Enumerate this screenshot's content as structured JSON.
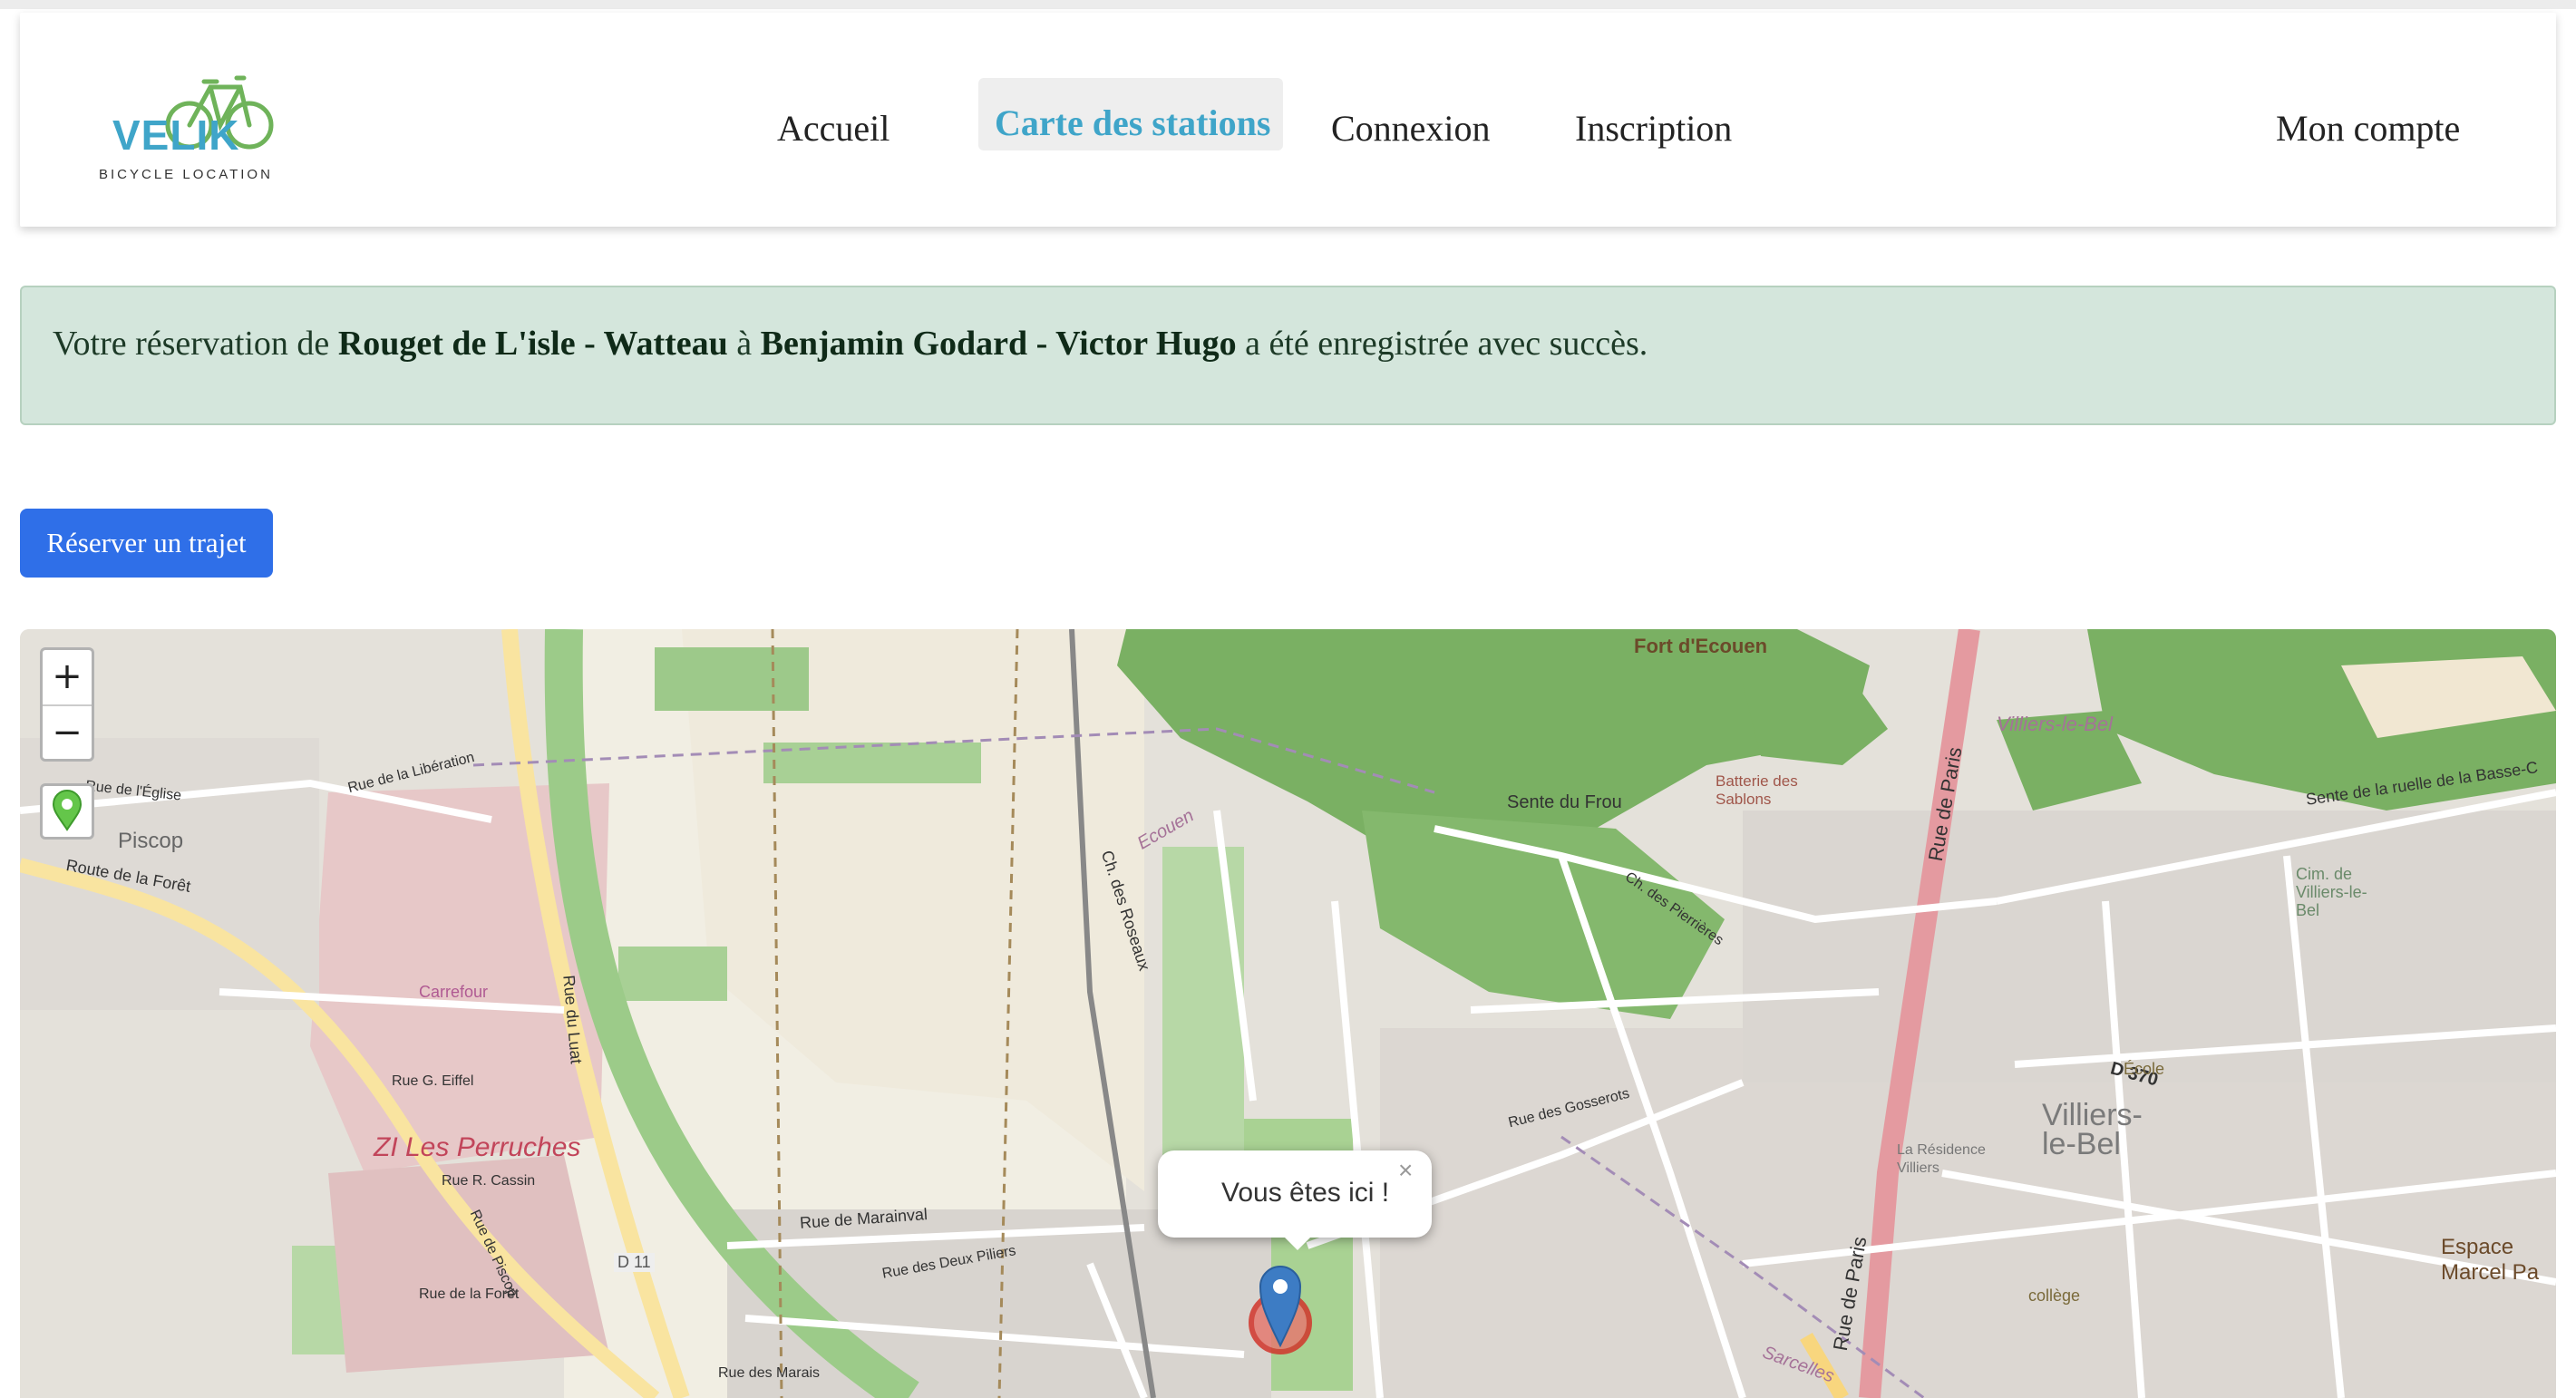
{
  "logo": {
    "word": "VELIK",
    "tagline": "BICYCLE LOCATION"
  },
  "nav": {
    "home": "Accueil",
    "stations_map": "Carte des stations",
    "login": "Connexion",
    "signup": "Inscription",
    "account": "Mon compte"
  },
  "alert": {
    "prefix": "Votre réservation de",
    "from_station": "Rouget de L'isle - Watteau",
    "connector": "à",
    "to_station": "Benjamin Godard - Victor Hugo",
    "suffix": "a été enregistrée avec succès."
  },
  "reserve_button": "Réserver un trajet",
  "map": {
    "zoom_in": "+",
    "zoom_out": "−",
    "popup_text": "Vous êtes ici !",
    "popup_close": "×",
    "labels": {
      "fort": "Fort d'Ecouen",
      "piscop": "Piscop",
      "carrefour": "Carrefour",
      "zi": "ZI Les Perruches",
      "villiers": "Villiers-le-Bel",
      "villiers_top": "Villiers-le-Bel",
      "route_foret": "Route de la Forêt",
      "rue_paris": "Rue de Paris",
      "rue_paris2": "Rue de Paris",
      "d370": "D 370",
      "d11": "D 11",
      "sente_frou": "Sente du Frou",
      "batterie": "Batterie des Sablons",
      "espace": "Espace Marcel Pa",
      "ecole": "École",
      "college": "collège",
      "rue_marainval": "Rue de Marainval",
      "rue_luat": "Rue du Luat",
      "chemin_roseaux": "Ch. des Roseaux",
      "rue_liberation": "Rue de la Libération",
      "ecouen": "Ecouen",
      "sarcelles": "Sarcelles",
      "sente_basse": "Sente de la ruelle de la Basse-C",
      "cim": "Cim. de Villiers-le-Bel",
      "residence": "La Résidence Villiers",
      "rue_gosserots": "Rue des Gosserots",
      "rue_foret2": "Rue de la Forêt",
      "rue_eglise": "Rue de l'Église",
      "rue_cassin": "Rue R. Cassin",
      "rue_eiffel": "Rue G. Eiffel",
      "rue_piscop": "Rue de Piscop",
      "deux_piliers": "Rue des Deux Piliers",
      "rue_marais": "Rue des Marais",
      "ch_pierres": "Ch. des Pierrières"
    }
  },
  "colors": {
    "brand": "#3fa5c9",
    "button": "#2f6fe8",
    "alert_bg": "#d4e6dc",
    "forest": "#7ab063",
    "main_road": "#e49aa0",
    "primary_road": "#f8d67e"
  }
}
